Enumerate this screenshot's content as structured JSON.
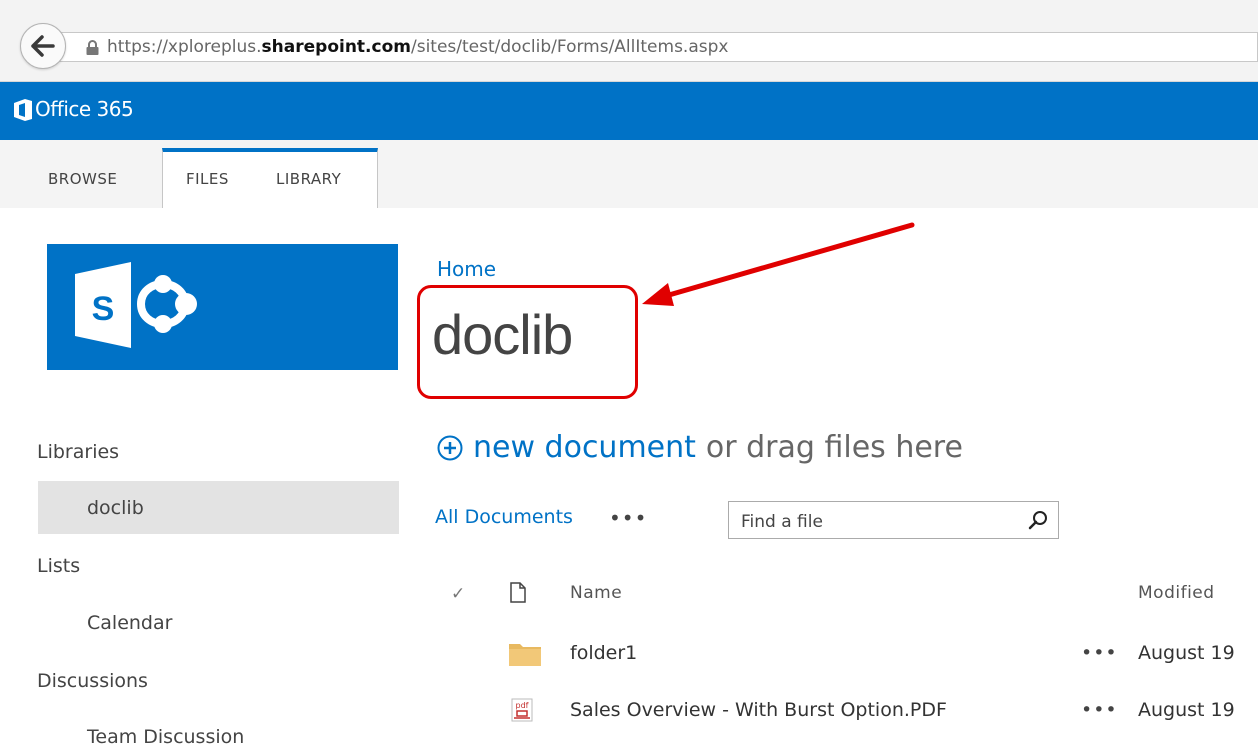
{
  "browser": {
    "url_prefix": "https://xploreplus.",
    "url_domain": "sharepoint.com",
    "url_path": "/sites/test/doclib/Forms/AllItems.aspx",
    "back_icon": "back-arrow-icon",
    "lock_icon": "lock-icon"
  },
  "suite_bar": {
    "brand": "Office 365",
    "logo_icon": "office-logo-icon",
    "color": "#0072c6"
  },
  "ribbon": {
    "tabs": [
      {
        "label": "BROWSE",
        "active": false
      },
      {
        "label": "FILES",
        "active": true
      },
      {
        "label": "LIBRARY",
        "active": true
      }
    ]
  },
  "site_logo": {
    "icon": "sharepoint-logo-icon",
    "letter": "S"
  },
  "left_nav": {
    "items": [
      {
        "label": "Libraries",
        "level": 0,
        "selected": false
      },
      {
        "label": "doclib",
        "level": 1,
        "selected": true
      },
      {
        "label": "Lists",
        "level": 0,
        "selected": false
      },
      {
        "label": "Calendar",
        "level": 1,
        "selected": false
      },
      {
        "label": "Discussions",
        "level": 0,
        "selected": false
      },
      {
        "label": "Team Discussion",
        "level": 1,
        "selected": false
      }
    ]
  },
  "main": {
    "breadcrumb": "Home",
    "title": "doclib",
    "new_document_link": "new document",
    "new_document_rest": "or drag files here",
    "view_label": "All Documents",
    "view_more": "•••",
    "search_placeholder": "Find a file",
    "annotation_color": "#e00000"
  },
  "document_list": {
    "columns": {
      "check": "✓",
      "name": "Name",
      "modified": "Modified"
    },
    "rows": [
      {
        "icon": "folder-icon",
        "name": "folder1",
        "more": "•••",
        "modified": "August 19"
      },
      {
        "icon": "pdf-file-icon",
        "name": "Sales Overview - With Burst Option.PDF",
        "more": "•••",
        "modified": "August 19"
      }
    ]
  }
}
